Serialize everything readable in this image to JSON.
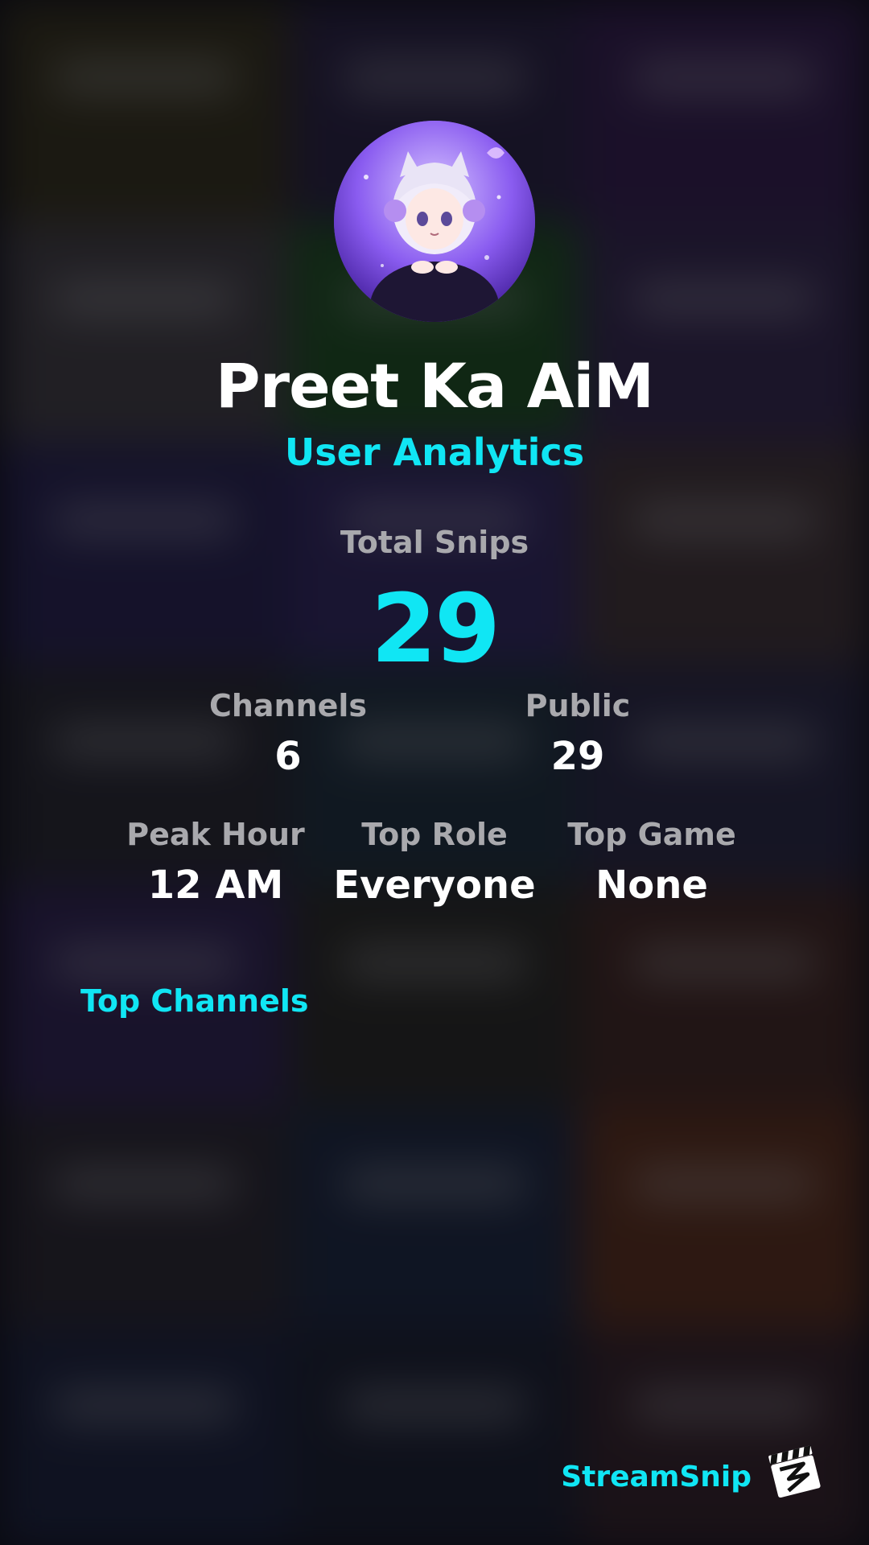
{
  "profile": {
    "username": "Preet Ka AiM",
    "subtitle": "User Analytics"
  },
  "stats": {
    "total_snips_label": "Total Snips",
    "total_snips_value": "29",
    "channels_label": "Channels",
    "channels_value": "6",
    "public_label": "Public",
    "public_value": "29",
    "peak_hour_label": "Peak Hour",
    "peak_hour_value": "12 AM",
    "top_role_label": "Top Role",
    "top_role_value": "Everyone",
    "top_game_label": "Top Game",
    "top_game_value": "None"
  },
  "top_channels": {
    "heading": "Top Channels",
    "items": []
  },
  "brand": {
    "name": "StreamSnip",
    "logo_icon": "clapperboard-icon"
  },
  "colors": {
    "accent": "#10e6f4",
    "label_gray": "#a9a9ad",
    "text_white": "#ffffff"
  }
}
